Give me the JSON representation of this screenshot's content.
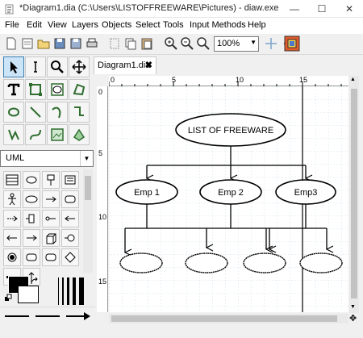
{
  "window": {
    "title": "*Diagram1.dia (C:\\Users\\LISTOFFREEWARE\\Pictures) - diaw.exe",
    "minimize": "—",
    "maximize": "☐",
    "close": "✕"
  },
  "menu": {
    "items": [
      "File",
      "Edit",
      "View",
      "Layers",
      "Objects",
      "Select",
      "Tools",
      "Input Methods",
      "Help"
    ]
  },
  "toolbar": {
    "zoom": "100%"
  },
  "left_panel": {
    "sheet": "UML"
  },
  "tab": {
    "label": "Diagram1.dia",
    "close": "✖"
  },
  "rulers": {
    "h_ticks": [
      "0",
      "5",
      "10",
      "15"
    ],
    "v_ticks": [
      "0",
      "5",
      "10",
      "15"
    ]
  },
  "diagram": {
    "root": "LIST OF FREEWARE",
    "level1": [
      "Emp 1",
      "Emp 2",
      "Emp3"
    ]
  },
  "colors": {
    "accent": "#3c7fb1",
    "canvas_grid": "#c8dce6",
    "ellipse_stroke": "#000000"
  }
}
